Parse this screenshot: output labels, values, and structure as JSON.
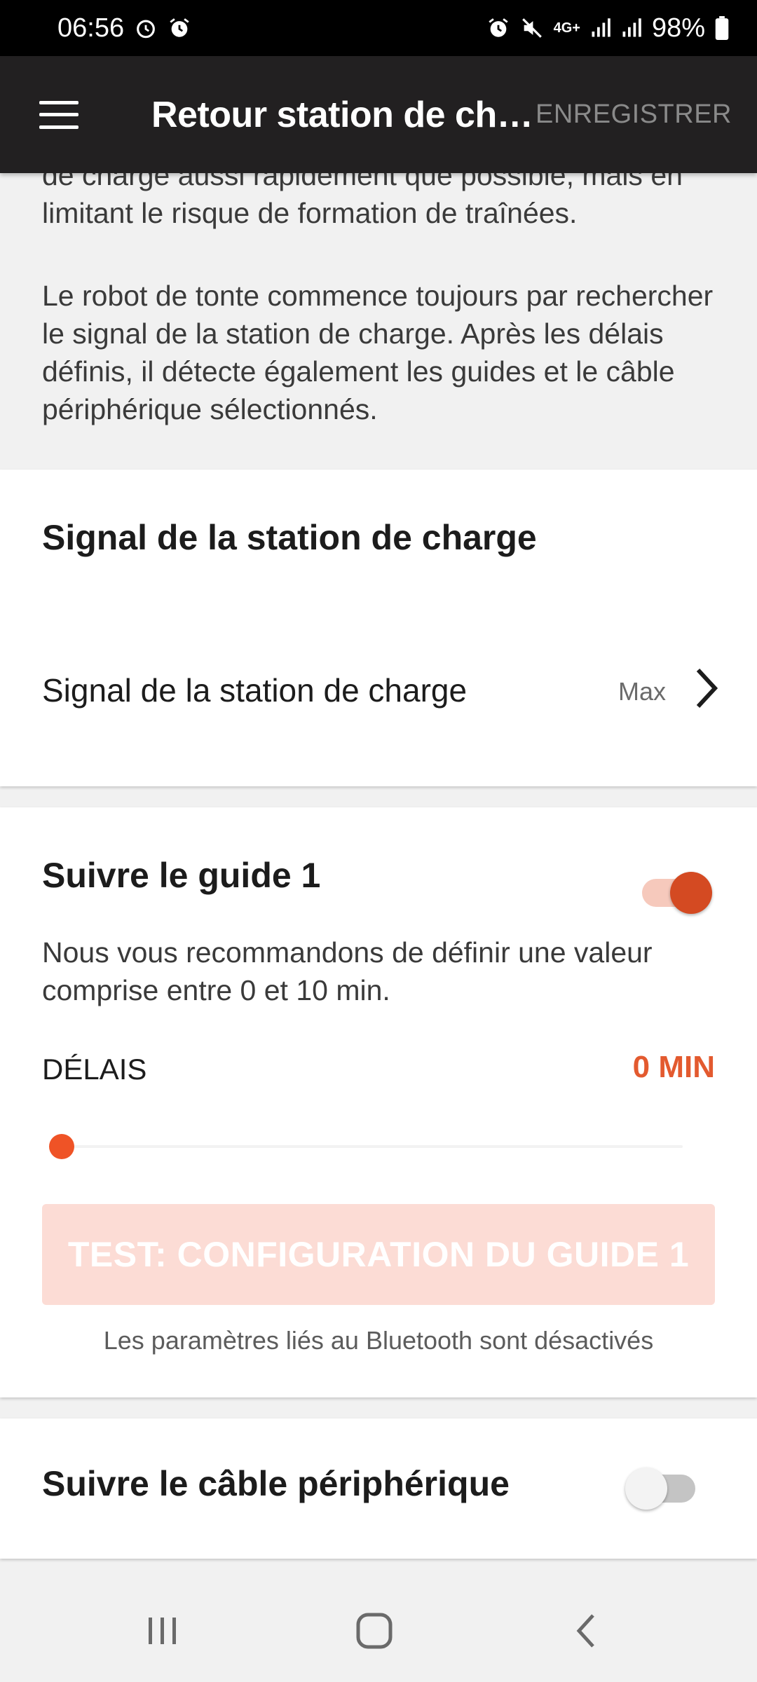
{
  "status_bar": {
    "time": "06:56",
    "battery": "98%",
    "network": "4G+"
  },
  "app_bar": {
    "title": "Retour station de charge",
    "save_label": "ENREGISTRER"
  },
  "intro": {
    "paragraph1": "de charge aussi rapidement que possible, mais en limitant le risque de formation de traînées.",
    "paragraph2": "Le robot de tonte commence toujours par rechercher le signal de la station de charge. Après les délais définis, il détecte également les guides et le câble périphérique sélectionnés."
  },
  "station_signal": {
    "title": "Signal de la station de charge",
    "row_label": "Signal de la station de charge",
    "row_value": "Max"
  },
  "guide1": {
    "title": "Suivre le guide 1",
    "toggle_on": true,
    "description": "Nous vous recommandons de définir une valeur comprise entre 0 et 10 min.",
    "delay_label": "DÉLAIS",
    "delay_value": "0 MIN",
    "slider_fraction": 0,
    "test_button": "TEST: CONFIGURATION DU GUIDE 1",
    "bluetooth_note": "Les paramètres liés au Bluetooth sont désactivés"
  },
  "boundary_wire": {
    "title": "Suivre le câble périphérique",
    "toggle_on": false
  },
  "colors": {
    "accent": "#e35a2f",
    "app_bar": "#222021",
    "disabled_button": "#fcdcd5"
  }
}
